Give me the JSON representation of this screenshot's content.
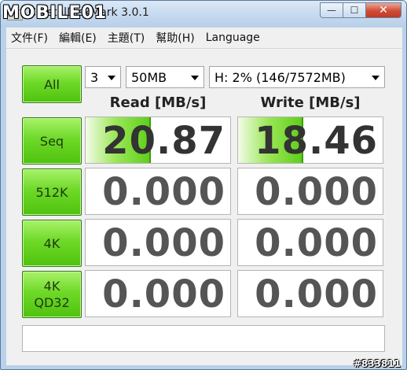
{
  "window": {
    "watermark": "MOBILE01",
    "title": "CrystalDiskMark 3.0.1",
    "buttons": {
      "minimize": "—",
      "maximize": "☐",
      "close": "✕"
    }
  },
  "menu": [
    "文件(F)",
    "編輯(E)",
    "主題(T)",
    "幫助(H)",
    "Language"
  ],
  "controls": {
    "all_label": "All",
    "runs": "3",
    "size": "50MB",
    "drive": "H: 2% (146/7572MB)"
  },
  "headers": {
    "read": "Read [MB/s]",
    "write": "Write [MB/s]"
  },
  "tests": [
    {
      "label": "Seq",
      "read": "20.87",
      "write": "18.46",
      "read_fill": 0.44,
      "write_fill": 0.44
    },
    {
      "label": "512K",
      "read": "0.000",
      "write": "0.000",
      "read_fill": 0,
      "write_fill": 0
    },
    {
      "label": "4K",
      "read": "0.000",
      "write": "0.000",
      "read_fill": 0,
      "write_fill": 0
    },
    {
      "label": "4K\nQD32",
      "read": "0.000",
      "write": "0.000",
      "read_fill": 0,
      "write_fill": 0
    }
  ],
  "status": "",
  "tag": "#833811",
  "colors": {
    "button_green": "#6fd928",
    "value_gray": "#555555"
  }
}
